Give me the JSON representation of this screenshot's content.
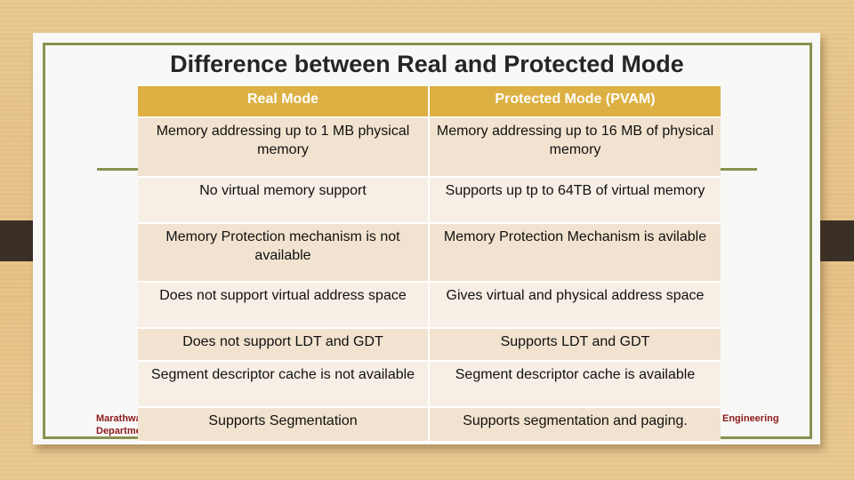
{
  "slide": {
    "title": "Difference between Real and Protected Mode",
    "footer_left_line1": "Marathwada",
    "footer_left_line2": "Department",
    "footer_right": "Engineering"
  },
  "table": {
    "headers": [
      "Real Mode",
      "Protected Mode (PVAM)"
    ],
    "rows": [
      [
        "Memory addressing up to 1 MB physical memory",
        "Memory addressing up to 16 MB of physical memory"
      ],
      [
        "No virtual memory support",
        "Supports up tp to 64TB of virtual memory"
      ],
      [
        "Memory Protection mechanism is not available",
        "Memory Protection Mechanism is avilable"
      ],
      [
        "Does not support virtual address space",
        "Gives virtual and physical address space"
      ],
      [
        "Does not support LDT and GDT",
        "Supports LDT and GDT"
      ],
      [
        "Segment descriptor cache is not available",
        "Segment descriptor cache is available"
      ],
      [
        "Supports Segmentation",
        "Supports segmentation and paging."
      ]
    ]
  },
  "colors": {
    "header_bg": "#dcb042",
    "row_odd": "#f1e3cf",
    "row_even": "#f7efe5",
    "frame_green": "#88924f",
    "footer_red": "#8b1a1a"
  }
}
